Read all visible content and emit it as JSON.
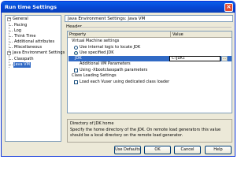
{
  "window": {
    "title": "Run time Settings"
  },
  "tree": {
    "items": [
      {
        "label": "General"
      },
      {
        "label": "Pacing"
      },
      {
        "label": "Log"
      },
      {
        "label": "Think Time"
      },
      {
        "label": "Additional attributes"
      },
      {
        "label": "Miscellaneous"
      },
      {
        "label": "Java Environment Settings"
      },
      {
        "label": "Classpath"
      },
      {
        "label": "Java VM"
      }
    ]
  },
  "panel": {
    "title": "Java Environment Settings: Java VM",
    "header_label": "Header",
    "columns": {
      "property": "Property",
      "value": "Value"
    },
    "rows": {
      "vm_settings": "Virtual Machine settings",
      "use_internal": "Use internal logic to locate JDK",
      "use_specified": "Use specified JDK",
      "jdk_label": "JDK",
      "jdk_value": "C:\\JDK1",
      "jdk_browse": "...",
      "additional_vm": "Additional VM Parameters",
      "use_bootclasspath": "Using -Xbootclasspath parameters",
      "class_loading": "Class Loading Settings",
      "load_each_vuser": "Load each Vuser using dedicated class loader"
    },
    "states": {
      "use_internal": false,
      "use_specified": true,
      "use_bootclasspath": false,
      "load_each_vuser": false
    }
  },
  "description": {
    "title": "Directory of JDK home",
    "text": "Specify the home directory of the JDK. On remote load generators this value should be a local directory on the remote load generator."
  },
  "buttons": {
    "defaults": "Use Defaults",
    "ok": "OK",
    "cancel": "Cancel",
    "help": "Help"
  },
  "colors": {
    "titlebar": "#0648d6",
    "selection": "#316ac5"
  },
  "icons": {
    "close": "close-icon"
  }
}
